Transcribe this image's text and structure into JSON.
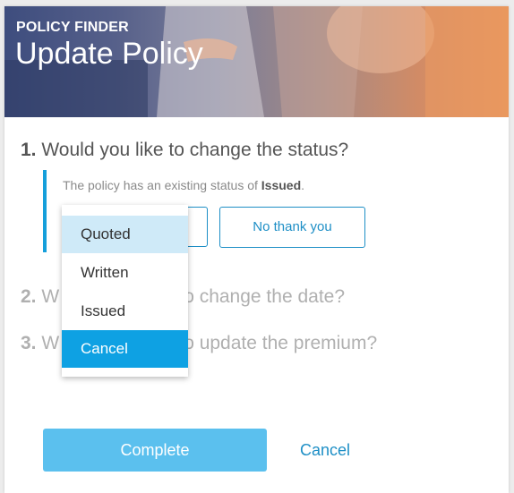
{
  "header": {
    "eyebrow": "POLICY FINDER",
    "title": "Update Policy"
  },
  "questions": [
    {
      "number": "1.",
      "text": "Would you like to change the status?"
    },
    {
      "number": "2.",
      "text_left": "W",
      "text_right": "o change the date?"
    },
    {
      "number": "3.",
      "text_left": "W",
      "text_right": "o update the premium?"
    }
  ],
  "status_note": {
    "prefix": "The policy has an existing status of ",
    "value": "Issued",
    "suffix": "."
  },
  "buttons": {
    "no_thank_you": "No thank you",
    "complete": "Complete",
    "cancel": "Cancel"
  },
  "status_dropdown": {
    "options": [
      "Quoted",
      "Written",
      "Issued",
      "Cancel"
    ],
    "hovered": "Quoted",
    "selected": "Cancel"
  },
  "colors": {
    "accent": "#1e8fc6",
    "selected": "#0ea1e3",
    "hover": "#cfeaf8",
    "complete_button": "#5bc0ee"
  }
}
